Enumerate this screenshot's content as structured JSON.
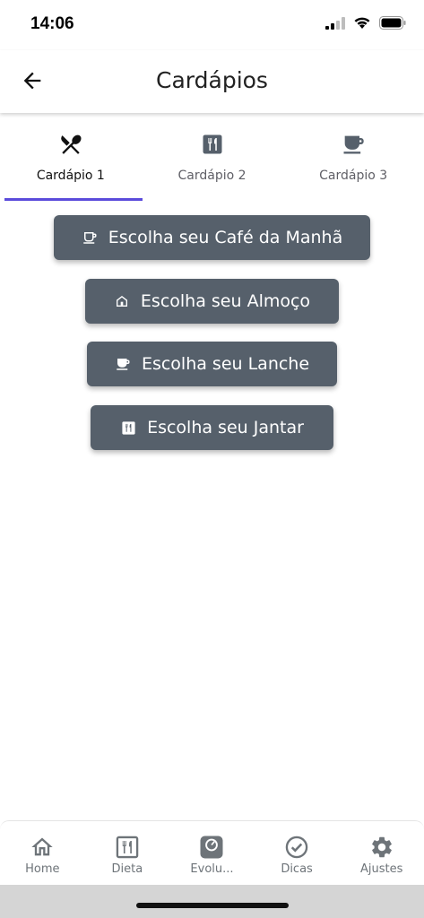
{
  "status_bar": {
    "time": "14:06"
  },
  "app_bar": {
    "title": "Cardápios"
  },
  "tabs": [
    {
      "label": "Cardápio 1",
      "icon": "utensils-crossed-icon",
      "active": true
    },
    {
      "label": "Cardápio 2",
      "icon": "restaurant-menu-icon",
      "active": false
    },
    {
      "label": "Cardápio 3",
      "icon": "coffee-cup-icon",
      "active": false
    }
  ],
  "meals": [
    {
      "label": "Escolha seu Café da Manhã",
      "icon": "coffee-icon"
    },
    {
      "label": "Escolha seu Almoço",
      "icon": "house-icon"
    },
    {
      "label": "Escolha seu Lanche",
      "icon": "cup-icon"
    },
    {
      "label": "Escolha seu Jantar",
      "icon": "restaurant-icon"
    }
  ],
  "bottom_nav": [
    {
      "label": "Home",
      "icon": "home-icon"
    },
    {
      "label": "Dieta",
      "icon": "menu-book-icon"
    },
    {
      "label": "Evolu...",
      "icon": "scale-icon"
    },
    {
      "label": "Dicas",
      "icon": "check-circle-icon"
    },
    {
      "label": "Ajustes",
      "icon": "gear-icon"
    }
  ],
  "colors": {
    "accent": "#5b4bdb",
    "button": "#56606b",
    "nav_icon": "#6e7479"
  }
}
